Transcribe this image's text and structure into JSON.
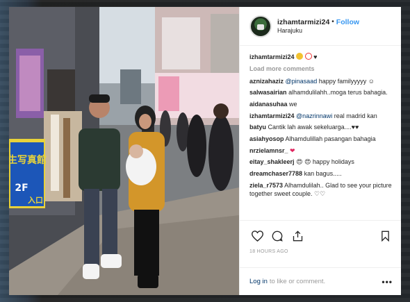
{
  "post": {
    "username": "izhamtarmizi24",
    "separator": "•",
    "follow_label": "Follow",
    "location": "Harajuku",
    "caption_user": "izhamtarmizi24",
    "caption_text": "",
    "load_more_label": "Load more comments",
    "timestamp": "18 HOURS AGO",
    "login_link": "Log in",
    "login_text": "to like or comment.",
    "more_label": "•••"
  },
  "comments": [
    {
      "user": "aznizahaziz",
      "mention": "@pinasaad",
      "text": "happy familyyyyy"
    },
    {
      "user": "salwasairian",
      "mention": "",
      "text": "alhamdulilahh..moga terus bahagia."
    },
    {
      "user": "aidanasuhaa",
      "mention": "",
      "text": "we"
    },
    {
      "user": "izhamtarmizi24",
      "mention": "@nazrinnawi",
      "text": "real madrid kan"
    },
    {
      "user": "batyu",
      "mention": "",
      "text": "Cantik lah awak sekeluarga....♥♥"
    },
    {
      "user": "asiahyosop",
      "mention": "",
      "text": "Alhamdulillah pasangan bahagia"
    },
    {
      "user": "nrzielamnsr_",
      "mention": "",
      "text": "❤"
    },
    {
      "user": "eitay_shakleerj",
      "mention": "",
      "text": "😍 😍 happy holidays"
    },
    {
      "user": "dreamchaser7788",
      "mention": "",
      "text": "kan bagus....."
    },
    {
      "user": "ziela_r7573",
      "mention": "",
      "text": "Alhamdulilah.. Glad to see your picture together sweet couple. ♡♡"
    }
  ],
  "photo": {
    "sign_text_1": "生写真館",
    "sign_text_2": "2F",
    "sign_text_3": "入口"
  },
  "icons": [
    "heart-icon",
    "comment-icon",
    "share-icon",
    "bookmark-icon"
  ],
  "colors": {
    "follow": "#3897f0",
    "mention": "#003569",
    "muted": "#999999"
  }
}
